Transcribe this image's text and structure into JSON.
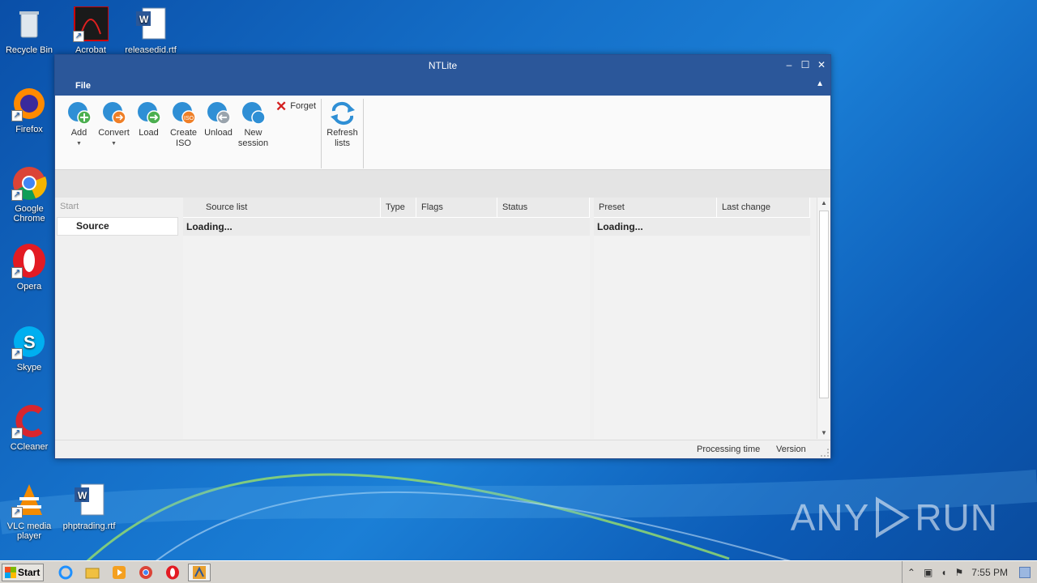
{
  "desktop": {
    "icons": [
      {
        "label": "Recycle Bin"
      },
      {
        "label": "Acrobat"
      },
      {
        "label": "releasedid.rtf"
      },
      {
        "label": "Firefox"
      },
      {
        "label": "Google Chrome"
      },
      {
        "label": "Opera"
      },
      {
        "label": "Skype"
      },
      {
        "label": "CCleaner"
      },
      {
        "label": "VLC media player"
      },
      {
        "label": "phptrading.rtf"
      }
    ],
    "watermark": {
      "left": "ANY",
      "right": "RUN"
    }
  },
  "window": {
    "title": "NTLite",
    "menu": {
      "file": "File"
    },
    "ribbon": {
      "add": "Add",
      "convert": "Convert",
      "load": "Load",
      "create_iso": "Create ISO",
      "unload": "Unload",
      "new_session": "New session",
      "forget": "Forget",
      "refresh_lists": "Refresh lists"
    },
    "nav": {
      "start": "Start",
      "source": "Source"
    },
    "source_grid": {
      "columns": [
        "Source list",
        "Type",
        "Flags",
        "Status"
      ],
      "loading": "Loading..."
    },
    "preset_grid": {
      "columns": [
        "Preset",
        "Last change"
      ],
      "loading": "Loading..."
    },
    "status": {
      "processing_time": "Processing time",
      "version": "Version"
    }
  },
  "taskbar": {
    "start": "Start",
    "clock": "7:55 PM"
  },
  "colors": {
    "titlebar": "#2b579a",
    "desktop": "#1570c9"
  }
}
